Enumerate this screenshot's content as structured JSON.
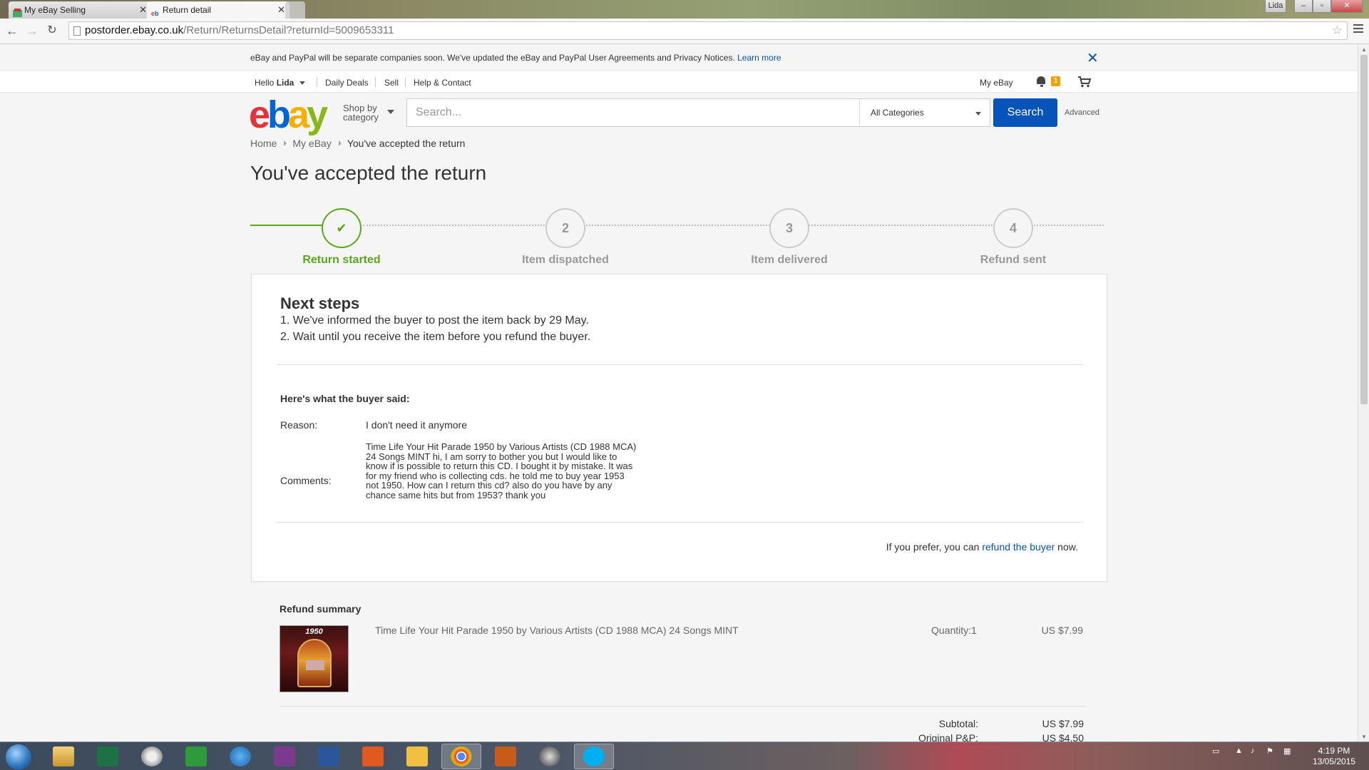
{
  "browser": {
    "tabs": [
      {
        "label": "My eBay Selling",
        "active": false
      },
      {
        "label": "Return detail",
        "active": true
      }
    ],
    "window_badge": "Lida",
    "url_host": "postorder.ebay.co.uk",
    "url_path": "/Return/ReturnsDetail?returnId=5009653311"
  },
  "notice": {
    "text": "eBay and PayPal will be separate companies soon. We've updated the eBay and PayPal User Agreements and Privacy Notices. ",
    "link": "Learn more",
    "close": "✕"
  },
  "globalnav": {
    "hello": "Hello ",
    "user": "Lida",
    "daily_deals": "Daily Deals",
    "sell": "Sell",
    "help": "Help & Contact",
    "my_ebay": "My eBay",
    "notification_count": "1"
  },
  "header": {
    "logo": {
      "e": "e",
      "b": "b",
      "a": "a",
      "y": "y"
    },
    "shop_by_category": "Shop by category",
    "search_placeholder": "Search...",
    "category_selected": "All Categories",
    "search_button": "Search",
    "advanced": "Advanced"
  },
  "breadcrumb": [
    "Home",
    "My eBay",
    "You've accepted the return"
  ],
  "page_title": "You've accepted the return",
  "progress": {
    "steps": [
      {
        "marker": "✔",
        "label": "Return started",
        "done": true
      },
      {
        "marker": "2",
        "label": "Item dispatched",
        "done": false
      },
      {
        "marker": "3",
        "label": "Item delivered",
        "done": false
      },
      {
        "marker": "4",
        "label": "Refund sent",
        "done": false
      }
    ],
    "accent": "#5ba71b"
  },
  "next_steps": {
    "heading": "Next steps",
    "items": [
      "1. We've informed the buyer to post the item back by 29 May.",
      "2. Wait until you receive the item before you refund the buyer."
    ]
  },
  "buyer": {
    "heading": "Here's what the buyer said:",
    "reason_label": "Reason:",
    "reason": "I don't need it anymore",
    "comments_label": "Comments:",
    "comments": "Time Life Your Hit Parade 1950 by Various Artists (CD 1988 MCA) 24 Songs MINT hi, I am sorry to bother you but I would like to know if is possible to return this CD. I bought it by mistake. It was for my friend who is collecting cds. he told me to buy year 1953 not 1950. How can I return this cd? also do you have by any chance same hits but from 1953? thank you"
  },
  "refund_prompt": {
    "before": "If you prefer, you can ",
    "link": "refund the buyer",
    "after": " now."
  },
  "refund_summary": {
    "heading": "Refund summary",
    "thumb_year": "1950",
    "item_title": "Time Life Your Hit Parade 1950 by Various Artists (CD 1988 MCA) 24 Songs MINT",
    "quantity": "Quantity:1",
    "price": "US $7.99",
    "subtotal_label": "Subtotal:",
    "subtotal": "US $7.99",
    "pp_label": "Original P&P:",
    "pp": "US $4.50"
  },
  "taskbar": {
    "clock_time": "4:19 PM",
    "clock_date": "13/05/2015"
  },
  "colors": {
    "link": "#0654ba",
    "search_button": "#0654ba",
    "badge": "#f2a100"
  }
}
